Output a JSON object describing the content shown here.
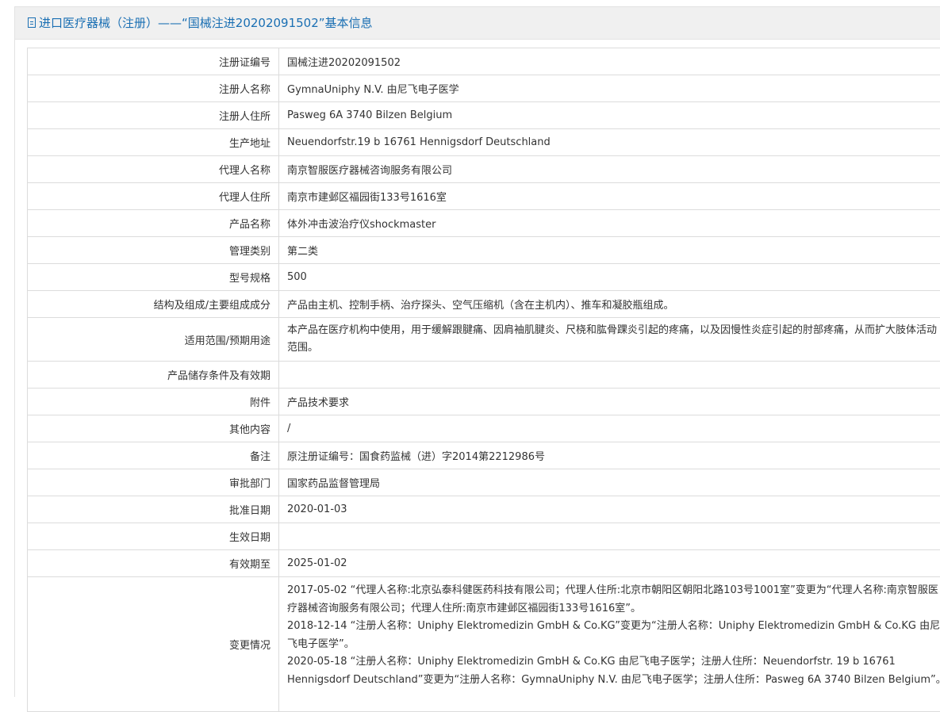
{
  "header": {
    "title": "进口医疗器械（注册）——“国械注进20202091502”基本信息"
  },
  "rows": [
    {
      "label": "注册证编号",
      "value": "国械注进20202091502"
    },
    {
      "label": "注册人名称",
      "value": "GymnaUniphy N.V. 由尼飞电子医学"
    },
    {
      "label": "注册人住所",
      "value": "Pasweg 6A 3740 Bilzen Belgium"
    },
    {
      "label": "生产地址",
      "value": "Neuendorfstr.19 b 16761 Hennigsdorf Deutschland"
    },
    {
      "label": "代理人名称",
      "value": "南京智服医疗器械咨询服务有限公司"
    },
    {
      "label": "代理人住所",
      "value": "南京市建邺区福园街133号1616室"
    },
    {
      "label": "产品名称",
      "value": "体外冲击波治疗仪shockmaster"
    },
    {
      "label": "管理类别",
      "value": "第二类"
    },
    {
      "label": "型号规格",
      "value": "500"
    },
    {
      "label": "结构及组成/主要组成成分",
      "value": "产品由主机、控制手柄、治疗探头、空气压缩机（含在主机内）、推车和凝胶瓶组成。"
    },
    {
      "label": "适用范围/预期用途",
      "value": "本产品在医疗机构中使用，用于缓解跟腱痛、因肩袖肌腱炎、尺桡和肱骨踝炎引起的疼痛，以及因慢性炎症引起的肘部疼痛，从而扩大肢体活动范围。"
    },
    {
      "label": "产品储存条件及有效期",
      "value": ""
    },
    {
      "label": "附件",
      "value": "产品技术要求"
    },
    {
      "label": "其他内容",
      "value": "/"
    },
    {
      "label": "备注",
      "value": "原注册证编号：国食药监械（进）字2014第2212986号"
    },
    {
      "label": "审批部门",
      "value": "国家药品监督管理局"
    },
    {
      "label": "批准日期",
      "value": "2020-01-03"
    },
    {
      "label": "生效日期",
      "value": ""
    },
    {
      "label": "有效期至",
      "value": "2025-01-02"
    }
  ],
  "changes": {
    "label": "变更情况",
    "entries": [
      "2017-05-02 “代理人名称:北京弘泰科健医药科技有限公司；代理人住所:北京市朝阳区朝阳北路103号1001室”变更为“代理人名称:南京智服医疗器械咨询服务有限公司；代理人住所:南京市建邺区福园街133号1616室”。",
      "2018-12-14 “注册人名称：Uniphy Elektromedizin GmbH & Co.KG”变更为“注册人名称：Uniphy Elektromedizin GmbH & Co.KG 由尼飞电子医学”。",
      "2020-05-18 “注册人名称：Uniphy Elektromedizin GmbH & Co.KG 由尼飞电子医学；注册人住所：Neuendorfstr. 19 b 16761 Hennigsdorf Deutschland”变更为“注册人名称：GymnaUniphy N.V. 由尼飞电子医学；注册人住所：Pasweg 6A 3740 Bilzen Belgium”。"
    ]
  }
}
